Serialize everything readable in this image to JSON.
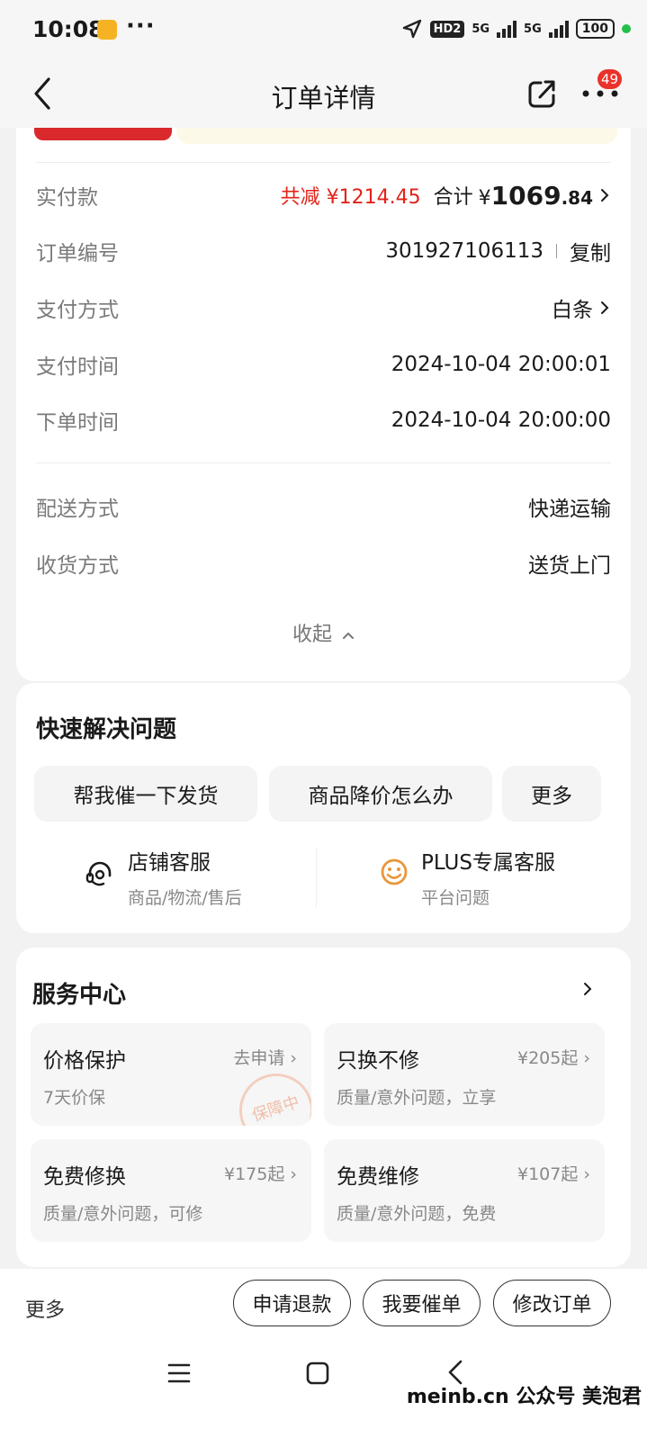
{
  "status_bar": {
    "time": "10:08",
    "dots": "···",
    "hd": "HD2",
    "signal1": "5G",
    "signal2": "5G",
    "battery": "100"
  },
  "header": {
    "title": "订单详情",
    "badge_count": "49"
  },
  "order_info": {
    "paid_label": "实付款",
    "discount_text": "共减 ¥1214.45",
    "total_label": "合计",
    "total_currency": "¥",
    "total_int": "1069",
    "total_dec": ".84",
    "order_no_label": "订单编号",
    "order_no": "301927106113",
    "copy_label": "复制",
    "pay_method_label": "支付方式",
    "pay_method": "白条",
    "pay_time_label": "支付时间",
    "pay_time": "2024-10-04 20:00:01",
    "order_time_label": "下单时间",
    "order_time": "2024-10-04 20:00:00",
    "delivery_label": "配送方式",
    "delivery": "快递运输",
    "receive_label": "收货方式",
    "receive": "送货上门",
    "collapse_label": "收起"
  },
  "quick_help": {
    "title": "快速解决问题",
    "chips": [
      "帮我催一下发货",
      "商品降价怎么办",
      "更多"
    ],
    "shop_service": {
      "title": "店铺客服",
      "subtitle": "商品/物流/售后"
    },
    "plus_service": {
      "title": "PLUS专属客服",
      "subtitle": "平台问题"
    }
  },
  "service_center": {
    "title": "服务中心",
    "tiles": [
      {
        "title": "价格保护",
        "action": "去申请",
        "sub": "7天价保",
        "stamp": "保障中"
      },
      {
        "title": "只换不修",
        "action": "¥205起",
        "sub": "质量/意外问题，立享"
      },
      {
        "title": "免费修换",
        "action": "¥175起",
        "sub": "质量/意外问题，可修"
      },
      {
        "title": "免费维修",
        "action": "¥107起",
        "sub": "质量/意外问题，免费"
      }
    ]
  },
  "bottom": {
    "more": "更多",
    "buttons": [
      "申请退款",
      "我要催单",
      "修改订单"
    ]
  },
  "watermark": "meinb.cn 公众号 美泡君",
  "colors": {
    "accent_red": "#e2231a",
    "badge_red": "#e9322b",
    "service_orange": "#e8963a"
  }
}
